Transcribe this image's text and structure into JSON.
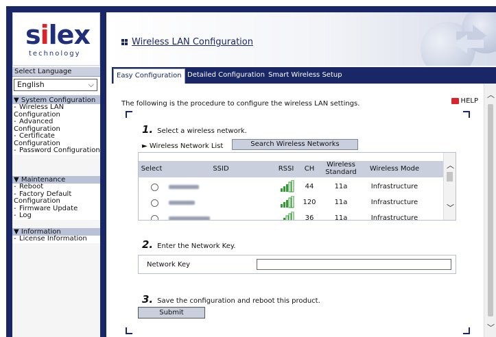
{
  "logo": {
    "brand": "silex",
    "tagline": "technology"
  },
  "language": {
    "label": "Select Language",
    "selected": "English"
  },
  "sidebar": {
    "system": {
      "heading": "▼ System Configuration",
      "items": [
        "Wireless LAN Configuration",
        "Advanced Configuration",
        "Certificate Configuration",
        "Password Configuration"
      ]
    },
    "maintenance": {
      "heading": "▼ Maintenance",
      "items": [
        "Reboot",
        "Factory Default Configuration",
        "Firmware Update",
        "Log"
      ]
    },
    "information": {
      "heading": "▼ Information",
      "items": [
        "License Information"
      ]
    }
  },
  "header": {
    "title": "Wireless LAN Configuration"
  },
  "tabs": [
    "Easy Configuration",
    "Detailed Configuration",
    "Smart Wireless Setup"
  ],
  "content": {
    "intro": "The following is the procedure to configure the wireless LAN settings.",
    "help": "HELP",
    "step1": {
      "num": "1.",
      "text": "Select a wireless network."
    },
    "list_label": "Wireless Network List",
    "search_button": "Search Wireless Networks",
    "table": {
      "headers": [
        "Select",
        "SSID",
        "RSSI",
        "CH",
        "Wireless Standard",
        "Wireless Mode"
      ],
      "rows": [
        {
          "ch": "44",
          "standard": "11a",
          "mode": "Infrastructure"
        },
        {
          "ch": "120",
          "standard": "11a",
          "mode": "Infrastructure"
        },
        {
          "ch": "36",
          "standard": "11a",
          "mode": "Infrastructure"
        }
      ]
    },
    "step2": {
      "num": "2.",
      "text": "Enter the Network Key."
    },
    "key_label": "Network Key",
    "step3": {
      "num": "3.",
      "text": "Save the configuration and reboot this product."
    },
    "submit": "Submit"
  },
  "colors": {
    "navy": "#1a2766",
    "brand_red": "#d8242a",
    "header_bg": "#c9cfdd"
  }
}
